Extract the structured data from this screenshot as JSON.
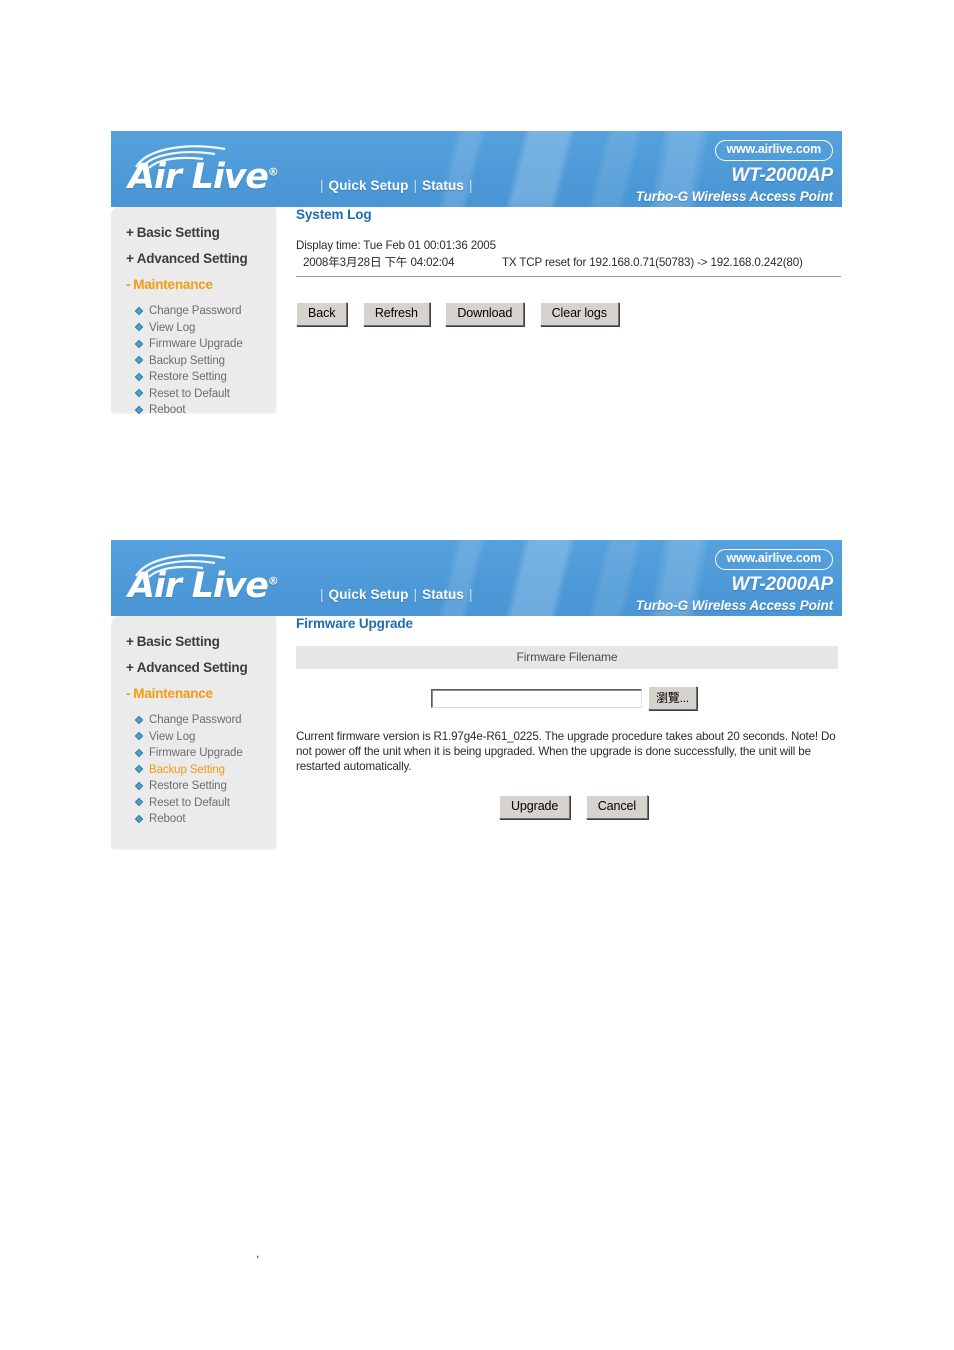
{
  "header": {
    "logo_text": "Air Live",
    "logo_registered": "®",
    "nav": [
      {
        "label": "Quick Setup"
      },
      {
        "label": "Status"
      }
    ],
    "url_badge": "www.airlive.com",
    "model": "WT-2000AP",
    "tagline": "Turbo-G Wireless Access Point",
    "bg_color": "#4e9ad8"
  },
  "sidebar": {
    "top_items": [
      {
        "prefix": "+",
        "label": "Basic Setting",
        "open": false
      },
      {
        "prefix": "+",
        "label": "Advanced Setting",
        "open": false
      },
      {
        "prefix": "-",
        "label": "Maintenance",
        "open": true
      }
    ],
    "sub_items": [
      {
        "label": "Change Password"
      },
      {
        "label": "View Log"
      },
      {
        "label": "Firmware Upgrade"
      },
      {
        "label": "Backup Setting"
      },
      {
        "label": "Restore Setting"
      },
      {
        "label": "Reset to Default"
      },
      {
        "label": "Reboot"
      }
    ],
    "active_color": "#f39b12",
    "bg_color": "#ebebeb"
  },
  "panel_log": {
    "title": "System Log",
    "display_time": "Display time: Tue Feb 01 00:01:36 2005",
    "entry": {
      "timestamp": "2008年3月28日 下午 04:02:04",
      "message": "TX TCP reset for 192.168.0.71(50783) -> 192.168.0.242(80)"
    },
    "buttons": [
      {
        "label": "Back"
      },
      {
        "label": "Refresh"
      },
      {
        "label": "Download"
      },
      {
        "label": "Clear logs"
      }
    ],
    "sidebar_active": ""
  },
  "panel_firmware": {
    "title": "Firmware Upgrade",
    "field_header": "Firmware Filename",
    "filename_value": "",
    "browse_label": "瀏覽...",
    "note_line1": "Current firmware version is R1.97g4e-R61_0225. The upgrade procedure takes about 20 seconds.",
    "note_line2": "Note! Do not power off the unit when it is being upgraded. When the upgrade is done successfully, the",
    "note_line3": "unit will be restarted automatically.",
    "firmware_version": "R1.97g4e-R61_0225",
    "upgrade_seconds": "20",
    "buttons": [
      {
        "label": "Upgrade"
      },
      {
        "label": "Cancel"
      }
    ],
    "sidebar_active": "Backup Setting"
  },
  "page": {
    "stray_mark": ","
  }
}
